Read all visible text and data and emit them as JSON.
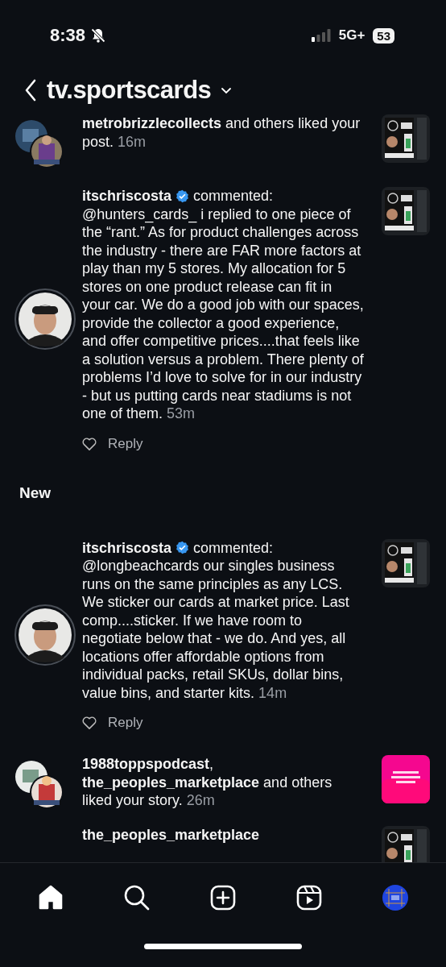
{
  "status_bar": {
    "time": "8:38",
    "network": "5G+",
    "battery": "53"
  },
  "header": {
    "title": "tv.sportscards"
  },
  "notifications": [
    {
      "kind": "like",
      "text": "**metrobrizzlecollects** and others liked your post.",
      "time": "16m"
    },
    {
      "kind": "comment",
      "user": "itschriscosta",
      "action": "commented:",
      "text": "@hunters_cards_ i replied to one piece of the “rant.” As for product challenges across the industry - there are FAR more factors at play than my 5 stores.  My allocation for 5 stores on one product release can fit in your car. We do a good job with our spaces, provide the collector a good experience, and offer competitive prices....that feels like a solution versus a problem.  There plenty of problems I’d love to solve for in our industry - but us putting cards near stadiums is not one of them.",
      "time": "53m",
      "reply": "Reply",
      "liked": false
    },
    {
      "kind": "heading",
      "text": "New"
    },
    {
      "kind": "comment",
      "user": "itschriscosta",
      "action": "commented:",
      "text": "@longbeachcards our singles business runs on the same principles as any LCS.  We sticker our cards at market price.  Last comp....sticker.  If we have room to negotiate below that - we do.  And yes, all locations offer affordable options from individual packs, retail SKUs, dollar bins, value bins, and starter kits.",
      "time": "14m",
      "reply": "Reply",
      "liked": false
    },
    {
      "kind": "like",
      "text": "**1988toppspodcast**, **the_peoples_marketplace** and others liked your story.",
      "time": "26m"
    },
    {
      "kind": "partial",
      "text": "the_peoples_marketplace"
    }
  ],
  "nav": [
    {
      "selected": true
    },
    {
      "selected": false
    },
    {
      "selected": false
    },
    {
      "selected": false
    },
    {
      "selected": false
    }
  ]
}
